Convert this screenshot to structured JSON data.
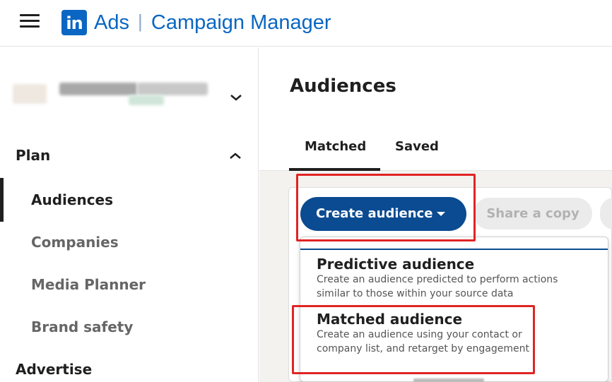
{
  "header": {
    "logo_text": "in",
    "product": "Ads",
    "separator": "|",
    "app_name": "Campaign Manager"
  },
  "sidebar": {
    "sections": [
      {
        "label": "Plan",
        "items": [
          "Audiences",
          "Companies",
          "Media Planner",
          "Brand safety"
        ]
      },
      {
        "label": "Advertise"
      }
    ],
    "active_item": "Audiences"
  },
  "main": {
    "title": "Audiences",
    "tabs": [
      {
        "label": "Matched",
        "selected": true
      },
      {
        "label": "Saved",
        "selected": false
      }
    ],
    "buttons": {
      "create": "Create audience",
      "share": "Share a copy"
    },
    "dropdown": {
      "options": [
        {
          "title": "Predictive audience",
          "desc_line1": "Create an audience predicted to perform actions",
          "desc_line2": "similar to those within your source data"
        },
        {
          "title": "Matched audience",
          "desc_line1": "Create an audience using your contact or",
          "desc_line2": "company list, and retarget by engagement"
        }
      ]
    }
  },
  "colors": {
    "brand": "#0a66c2",
    "primary_button": "#0a4b91",
    "highlight": "#e02424",
    "page_bg": "#f3f2ef"
  }
}
